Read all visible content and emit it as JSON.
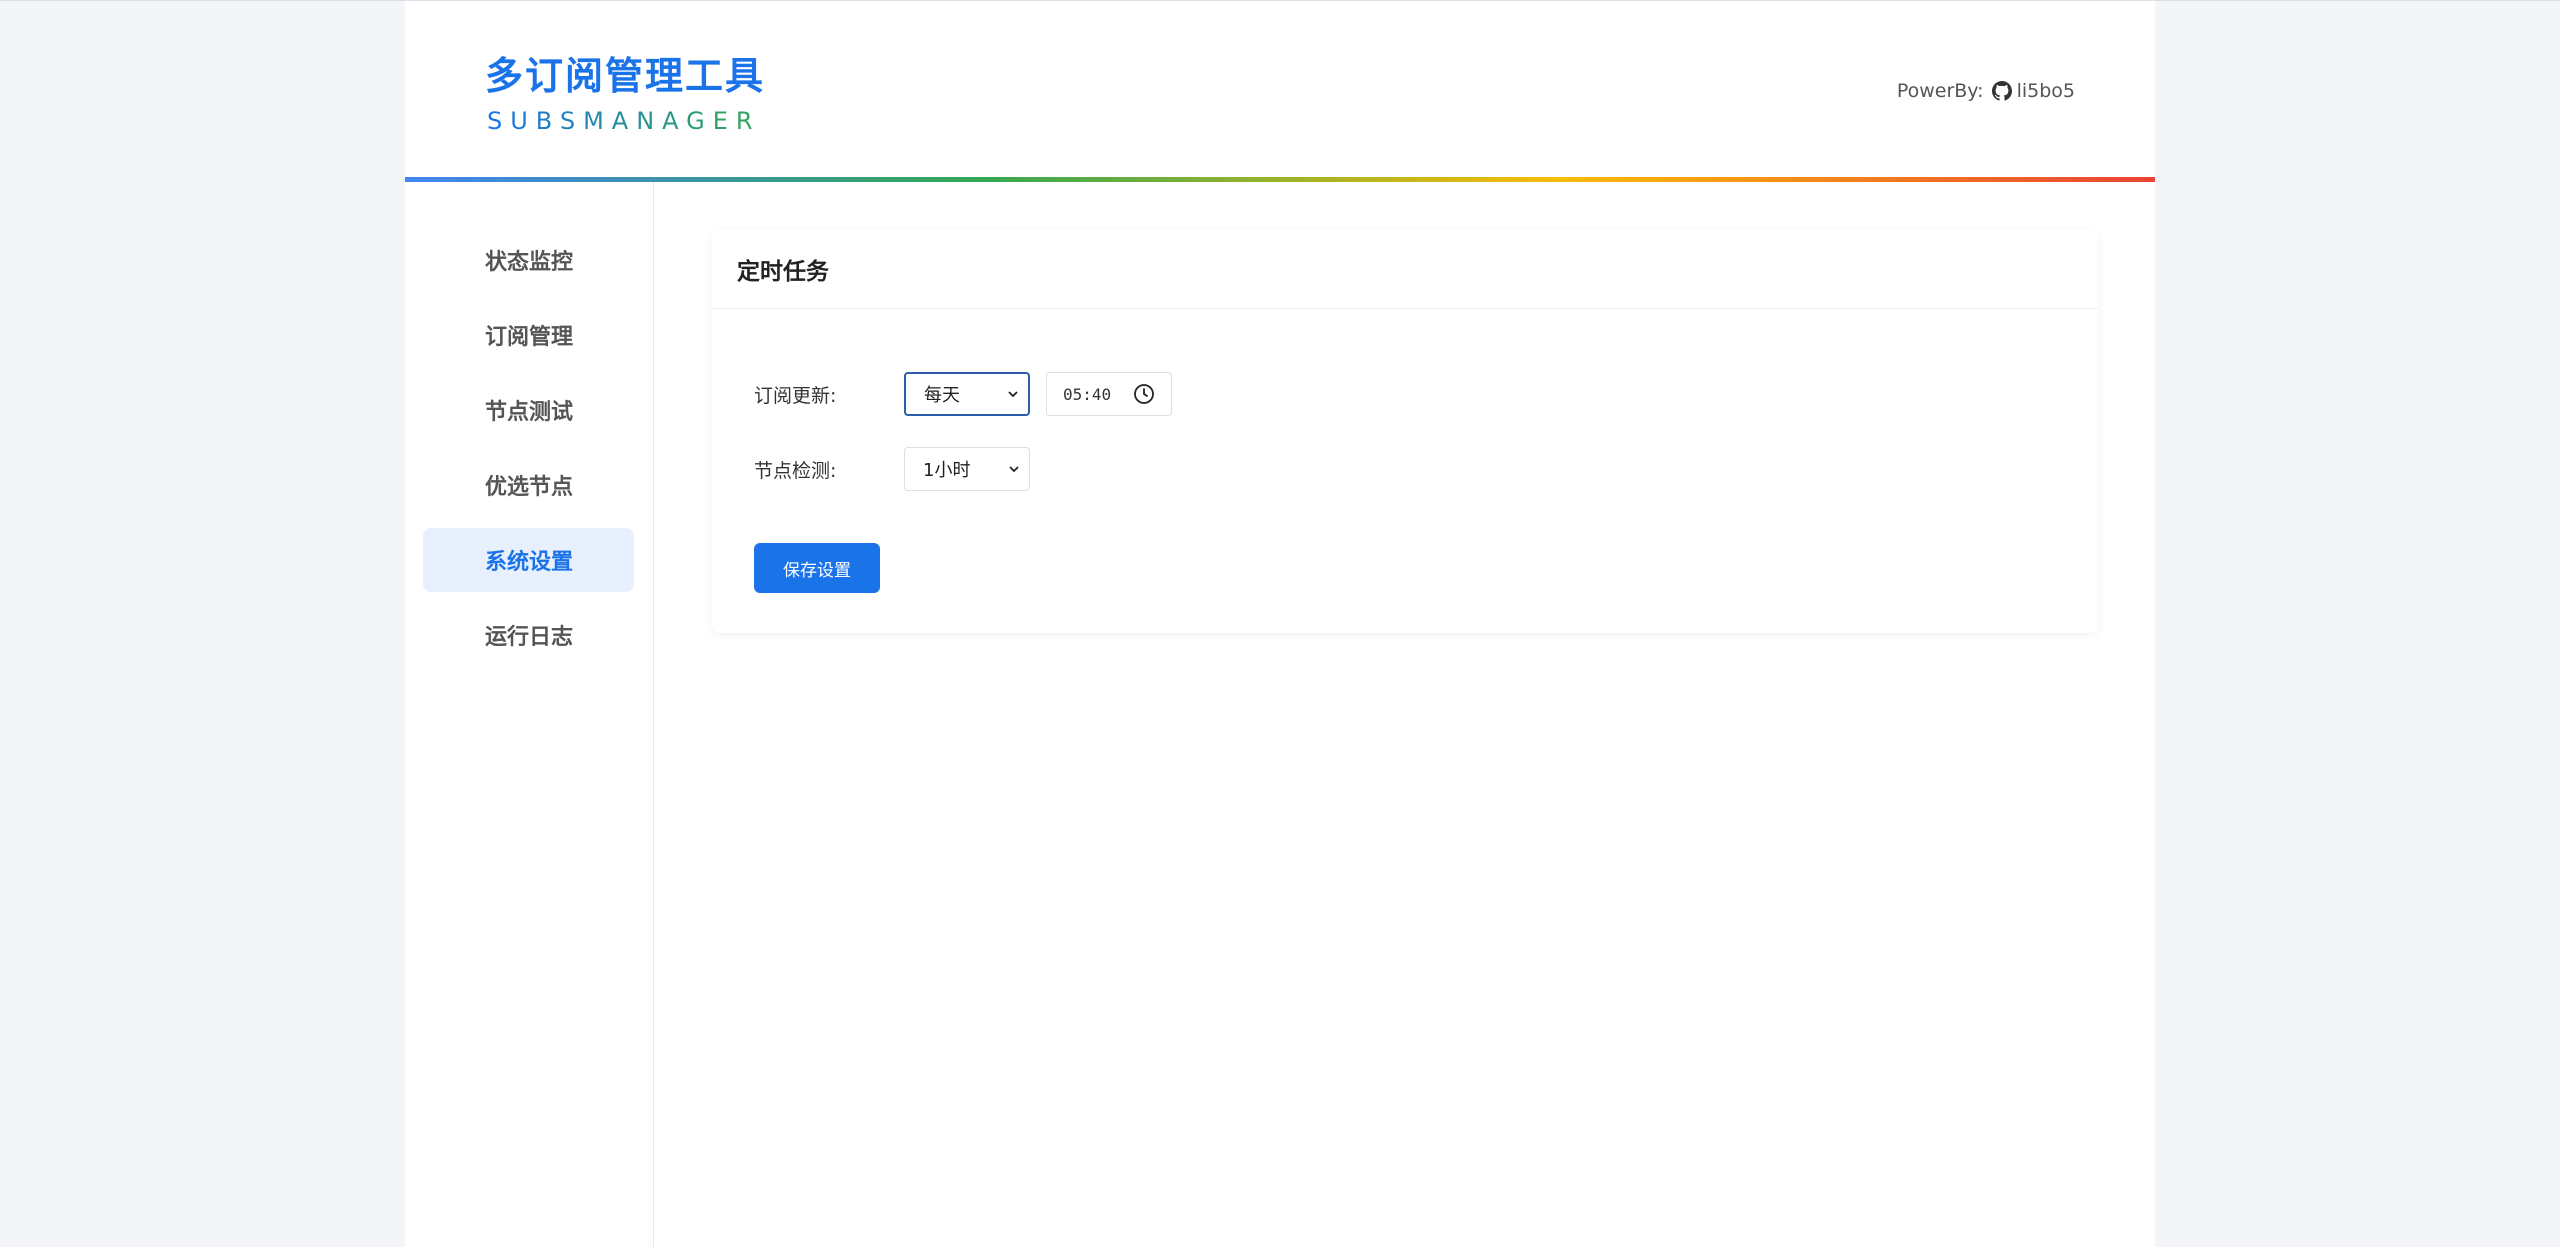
{
  "app": {
    "title": "多订阅管理工具",
    "subtitle": "SUBSMANAGER",
    "powered_by_label": "PowerBy:",
    "github_user": "li5bo5",
    "github_icon": "github-icon"
  },
  "sidebar": {
    "items": [
      {
        "label": "状态监控",
        "active": false
      },
      {
        "label": "订阅管理",
        "active": false
      },
      {
        "label": "节点测试",
        "active": false
      },
      {
        "label": "优选节点",
        "active": false
      },
      {
        "label": "系统设置",
        "active": true
      },
      {
        "label": "运行日志",
        "active": false
      }
    ]
  },
  "card": {
    "title": "定时任务",
    "subscription_update": {
      "label": "订阅更新:",
      "frequency": "每天",
      "time": "05:40"
    },
    "node_check": {
      "label": "节点检测:",
      "interval": "1小时"
    },
    "save_label": "保存设置"
  },
  "colors": {
    "accent": "#1a73e8",
    "active_bg": "#e8f0fe",
    "page_bg": "#f3f5f9"
  }
}
